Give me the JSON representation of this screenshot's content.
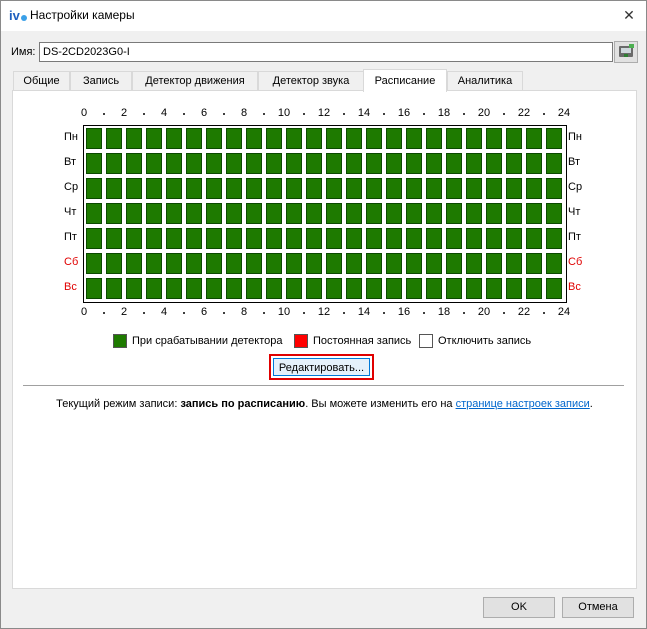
{
  "window": {
    "title": "Настройки камеры",
    "app_icon": "iv-logo-icon",
    "close_glyph": "✕"
  },
  "name_field": {
    "label": "Имя:",
    "value": "DS-2CD2023G0-I"
  },
  "tabs": [
    {
      "label": "Общие",
      "active": false
    },
    {
      "label": "Запись",
      "active": false
    },
    {
      "label": "Детектор движения",
      "active": false
    },
    {
      "label": "Детектор звука",
      "active": false
    },
    {
      "label": "Расписание",
      "active": true
    },
    {
      "label": "Аналитика",
      "active": false
    }
  ],
  "schedule": {
    "hour_labels": [
      "0",
      "2",
      "4",
      "6",
      "8",
      "10",
      "12",
      "14",
      "16",
      "18",
      "20",
      "22",
      "24"
    ],
    "days": [
      {
        "label": "Пн",
        "weekend": false
      },
      {
        "label": "Вт",
        "weekend": false
      },
      {
        "label": "Ср",
        "weekend": false
      },
      {
        "label": "Чт",
        "weekend": false
      },
      {
        "label": "Пт",
        "weekend": false
      },
      {
        "label": "Сб",
        "weekend": true
      },
      {
        "label": "Вс",
        "weekend": true
      }
    ],
    "slots_per_day": 24,
    "all_slots_mode": "detector",
    "colors": {
      "detector": "#1e7a00",
      "continuous": "#ff0000",
      "off": "#ffffff",
      "weekend_label": "#e00000"
    }
  },
  "legend": [
    {
      "label": "При срабатывании детектора",
      "color": "#1e7a00"
    },
    {
      "label": "Постоянная запись",
      "color": "#ff0000"
    },
    {
      "label": "Отключить запись",
      "color": "#ffffff"
    }
  ],
  "edit_button": {
    "label": "Редактировать..."
  },
  "status": {
    "prefix": "Текущий режим записи: ",
    "mode": "запись по расписанию",
    "middle": ". Вы можете изменить его на ",
    "link": "странице настроек записи",
    "suffix": "."
  },
  "footer": {
    "ok_label": "OK",
    "cancel_label": "Отмена"
  }
}
